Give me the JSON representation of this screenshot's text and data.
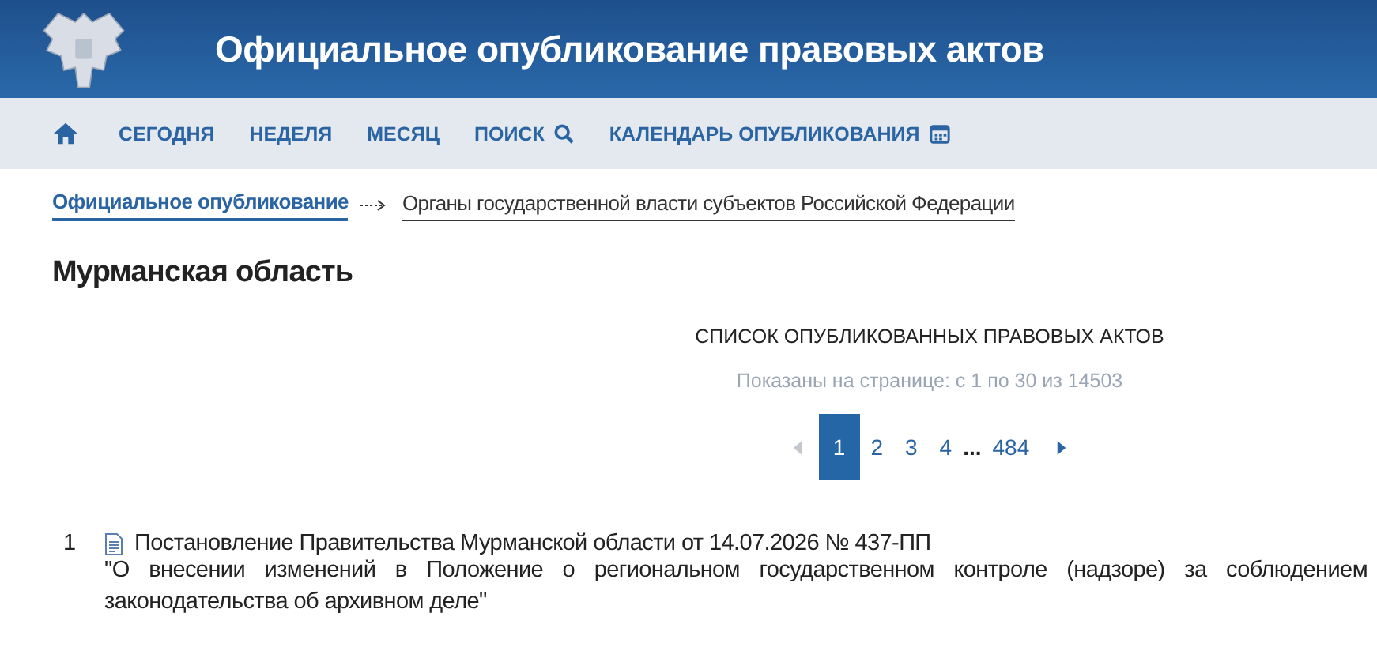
{
  "header": {
    "title": "Официальное опубликование правовых актов"
  },
  "nav": {
    "items": [
      {
        "label": "СЕГОДНЯ",
        "kind": "plain"
      },
      {
        "label": "НЕДЕЛЯ",
        "kind": "plain"
      },
      {
        "label": "МЕСЯЦ",
        "kind": "plain"
      },
      {
        "label": "ПОИСК",
        "kind": "search"
      },
      {
        "label": "КАЛЕНДАРЬ ОПУБЛИКОВАНИЯ",
        "kind": "calendar"
      }
    ]
  },
  "breadcrumb": [
    {
      "label": "Официальное опубликование",
      "current": false
    },
    {
      "label": "Органы государственной власти субъектов Российской Федерации",
      "current": true
    }
  ],
  "page_title": "Мурманская область",
  "list_title": "СПИСОК ОПУБЛИКОВАННЫХ ПРАВОВЫХ АКТОВ",
  "shown_info": "Показаны на странице: с 1 по 30 из 14503",
  "pagination": {
    "prev_disabled": true,
    "next_disabled": false,
    "items": [
      {
        "kind": "page",
        "label": "1",
        "selected": true
      },
      {
        "kind": "page",
        "label": "2",
        "selected": false
      },
      {
        "kind": "page",
        "label": "3",
        "selected": false
      },
      {
        "kind": "page",
        "label": "4",
        "selected": false
      },
      {
        "kind": "ellipsis",
        "label": "..."
      },
      {
        "kind": "page",
        "label": "484",
        "selected": false
      }
    ]
  },
  "documents": [
    {
      "number": "1",
      "title": "Постановление Правительства Мурманской области от 14.07.2026 № 437-ПП",
      "description": "\"О внесении изменений в Положение о региональном государственном контроле (надзоре) за соблюдением законодательства об архивном деле\""
    }
  ]
}
